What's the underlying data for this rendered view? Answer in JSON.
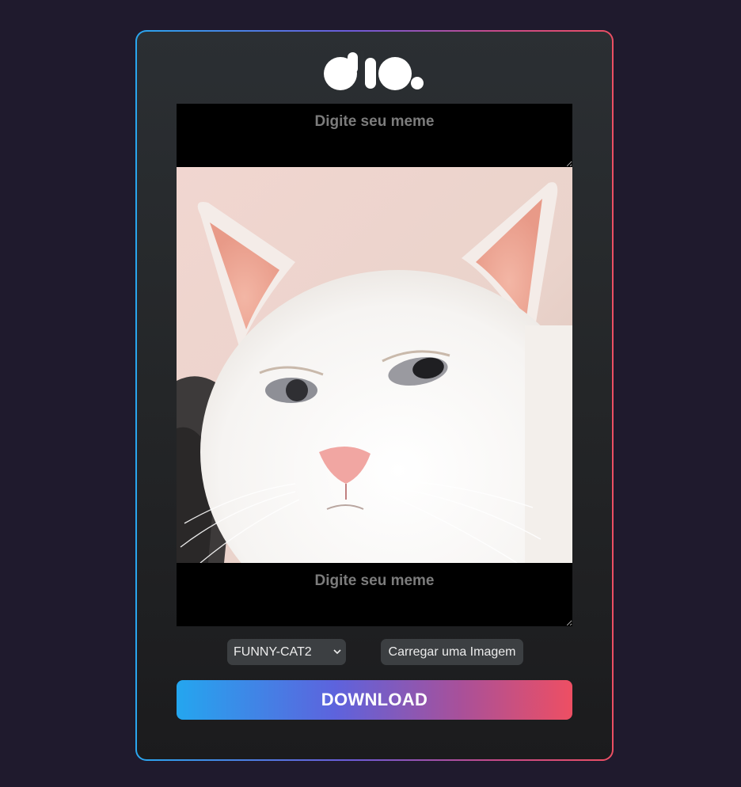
{
  "logo": {
    "icon": "dio-logo"
  },
  "top_text": {
    "placeholder": "Digite seu meme",
    "value": ""
  },
  "bottom_text": {
    "placeholder": "Digite seu meme",
    "value": ""
  },
  "meme_image": {
    "subject": "white-cat-photo"
  },
  "image_select": {
    "selected": "FUNNY-CAT2"
  },
  "upload": {
    "label": "Carregar uma Imagem"
  },
  "download": {
    "label": "DOWNLOAD"
  },
  "colors": {
    "page_background": "#1f1a2d",
    "card_background": "#27292c",
    "gradient_start": "#24a6ef",
    "gradient_mid": "#6c5bd8",
    "gradient_end": "#ee4f63",
    "control_background": "#3c3f42"
  }
}
